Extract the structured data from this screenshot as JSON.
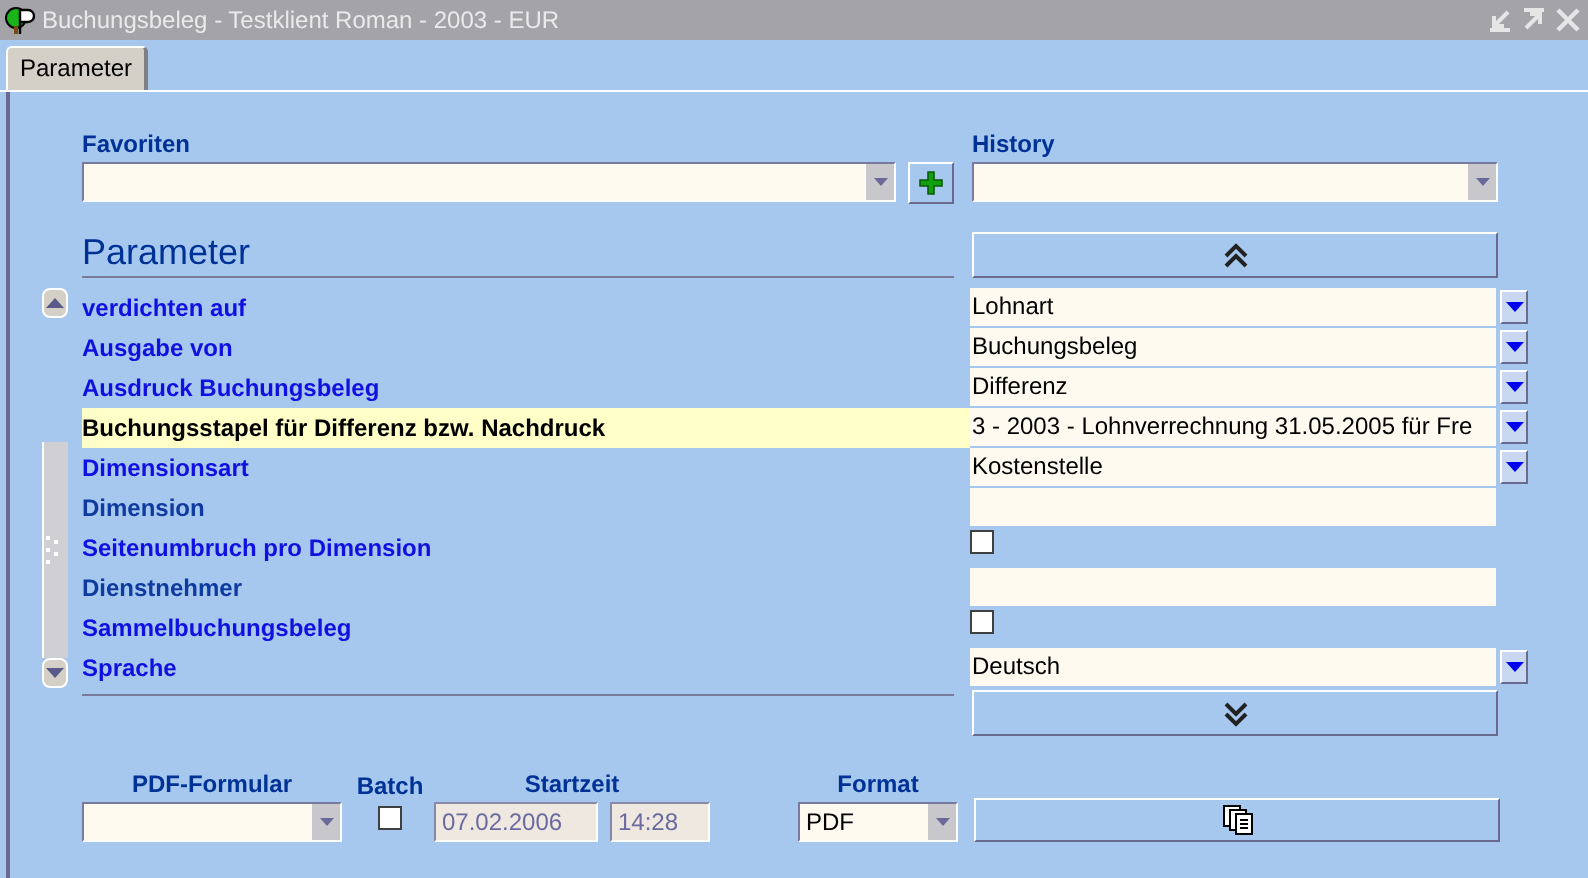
{
  "window": {
    "title": "Buchungsbeleg - Testklient Roman - 2003 - EUR"
  },
  "tabs": [
    {
      "label": "Parameter",
      "selected": true
    }
  ],
  "favorites": {
    "label": "Favoriten"
  },
  "history": {
    "label": "History"
  },
  "parameters": {
    "heading": "Parameter",
    "rows": [
      {
        "label": "verdichten auf",
        "kind": "dropdown",
        "value": "Lohnart",
        "selected": false,
        "dimmed": false
      },
      {
        "label": "Ausgabe von",
        "kind": "dropdown",
        "value": "Buchungsbeleg",
        "selected": false,
        "dimmed": false
      },
      {
        "label": "Ausdruck Buchungsbeleg",
        "kind": "dropdown",
        "value": "Differenz",
        "selected": false,
        "dimmed": false
      },
      {
        "label": "Buchungsstapel für Differenz bzw. Nachdruck",
        "kind": "dropdown",
        "value": "3 - 2003 - Lohnverrechnung 31.05.2005 für Fre",
        "selected": true,
        "dimmed": false
      },
      {
        "label": "Dimensionsart",
        "kind": "dropdown",
        "value": "Kostenstelle",
        "selected": false,
        "dimmed": false
      },
      {
        "label": "Dimension",
        "kind": "text",
        "selected": false,
        "dimmed": true
      },
      {
        "label": "Seitenumbruch pro Dimension",
        "kind": "checkbox",
        "checked": false,
        "selected": false,
        "dimmed": false
      },
      {
        "label": "Dienstnehmer",
        "kind": "text",
        "selected": false,
        "dimmed": true
      },
      {
        "label": "Sammelbuchungsbeleg",
        "kind": "checkbox",
        "checked": false,
        "selected": false,
        "dimmed": false
      },
      {
        "label": "Sprache",
        "kind": "dropdown",
        "value": "Deutsch",
        "selected": false,
        "dimmed": false
      }
    ]
  },
  "bottom": {
    "pdf_form": {
      "label": "PDF-Formular"
    },
    "batch": {
      "label": "Batch",
      "checked": false
    },
    "start": {
      "label": "Startzeit",
      "date": "07.02.2006",
      "time": "14:28",
      "disabled": true
    },
    "format": {
      "label": "Format",
      "value": "PDF"
    }
  }
}
